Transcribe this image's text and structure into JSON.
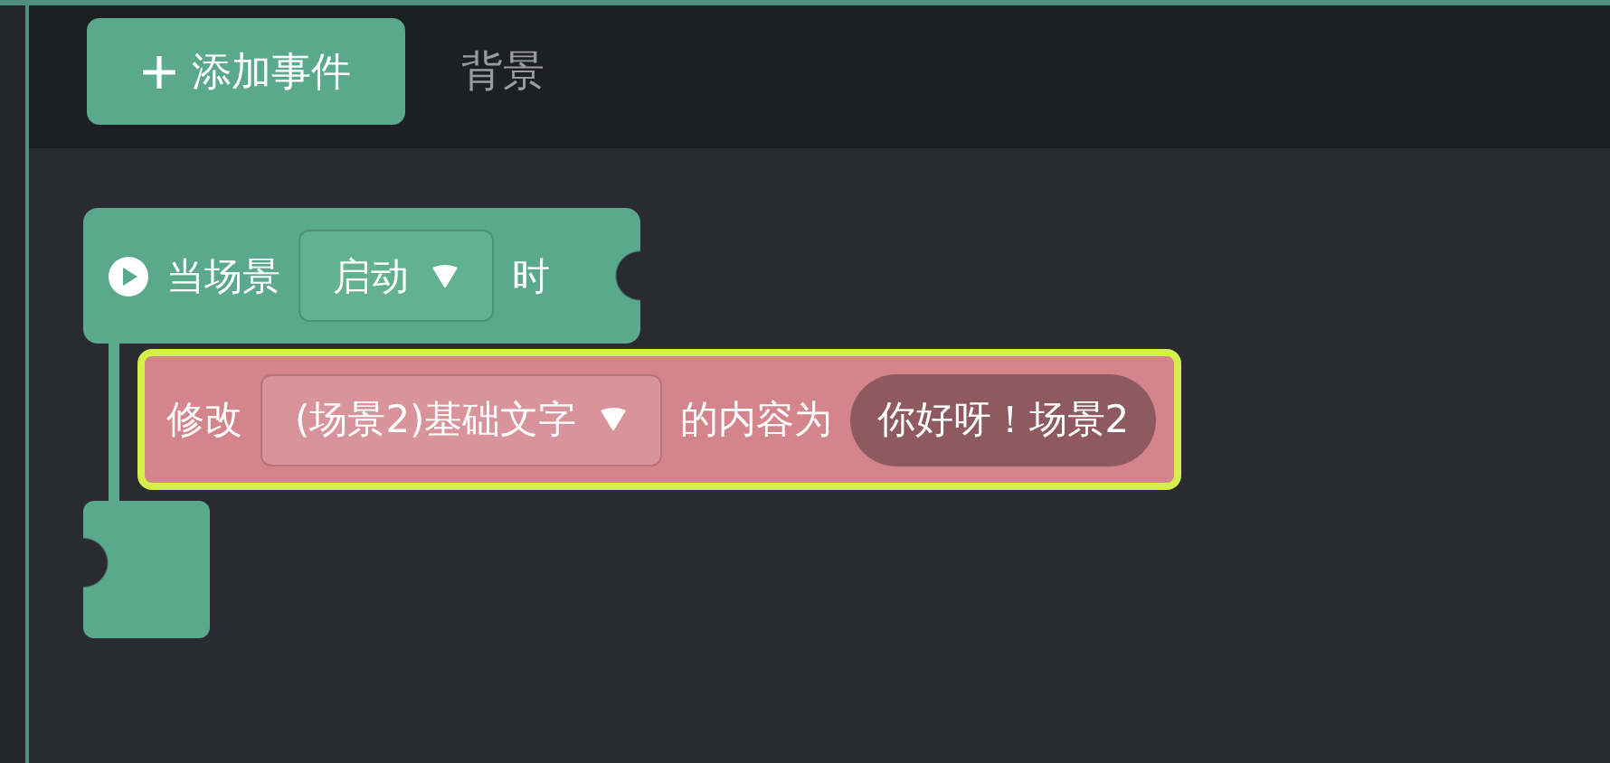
{
  "toolbar": {
    "add_event_button": "添加事件",
    "tab": "背景"
  },
  "blocks": [
    {
      "kind": "event",
      "parts": [
        {
          "kind": "icon"
        },
        {
          "kind": "text",
          "text": "当场景"
        },
        {
          "kind": "dropdown",
          "text": "启动"
        },
        {
          "kind": "text",
          "text": "时"
        }
      ],
      "children": [
        {
          "kind": "action",
          "selected": true,
          "parts": [
            {
              "kind": "text",
              "text": "修改"
            },
            {
              "kind": "dropdown",
              "text": "(场景2)基础文字"
            },
            {
              "kind": "text",
              "text": "的内容为"
            },
            {
              "kind": "value",
              "text": "你好呀！场景2"
            }
          ]
        }
      ]
    }
  ]
}
